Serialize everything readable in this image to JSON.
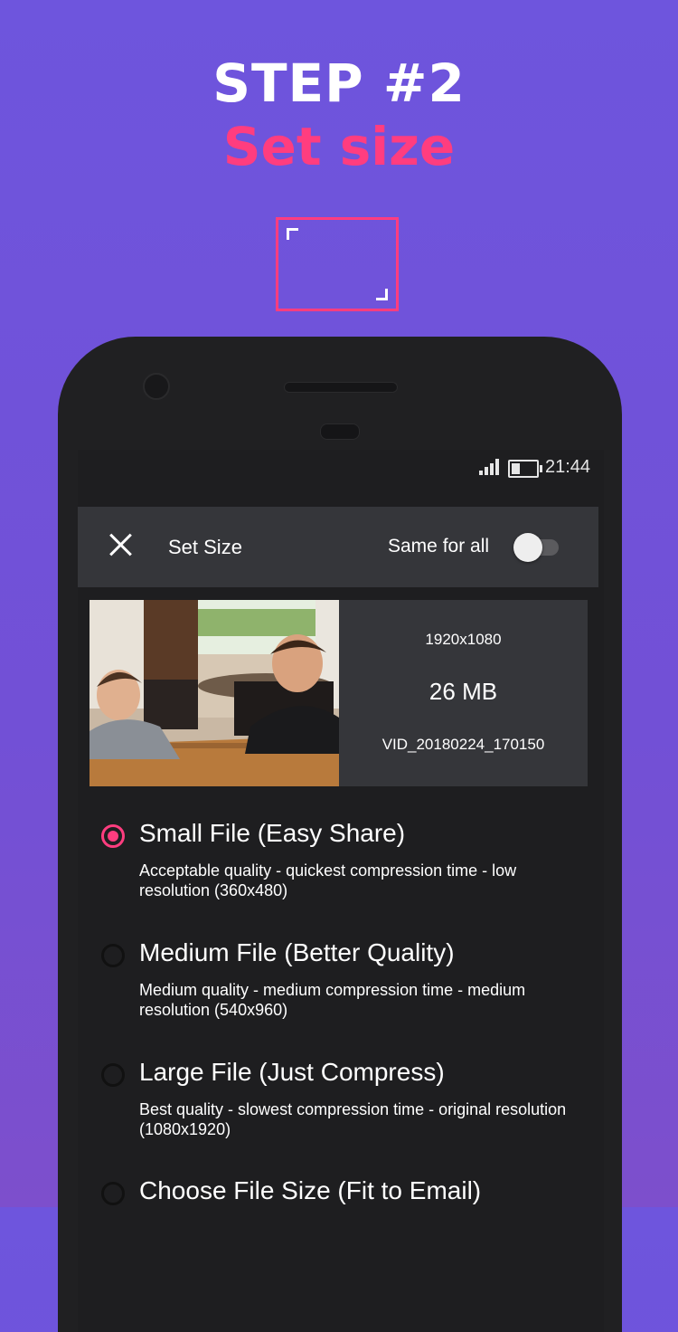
{
  "promo": {
    "step": "STEP #2",
    "subtitle": "Set size",
    "frame_icon": "resize-frame-icon",
    "accent_color": "#ff3d7f",
    "background_color": "#6e55dd"
  },
  "status_bar": {
    "signal_icon": "signal-icon",
    "battery_icon": "battery-icon",
    "time": "21:44"
  },
  "toolbar": {
    "close_icon": "close-icon",
    "title": "Set Size",
    "same_for_all_label": "Same for all",
    "same_for_all_enabled": false
  },
  "video": {
    "resolution": "1920x1080",
    "size": "26 MB",
    "filename": "VID_20180224_170150"
  },
  "options": [
    {
      "title": "Small File (Easy Share)",
      "description": "Acceptable quality - quickest compression time - low resolution (360x480)",
      "selected": true
    },
    {
      "title": "Medium File (Better Quality)",
      "description": "Medium quality - medium compression time - medium resolution (540x960)",
      "selected": false
    },
    {
      "title": "Large File (Just Compress)",
      "description": "Best quality - slowest compression time - original resolution (1080x1920)",
      "selected": false
    },
    {
      "title": "Choose File Size (Fit to Email)",
      "description": "",
      "selected": false
    }
  ]
}
